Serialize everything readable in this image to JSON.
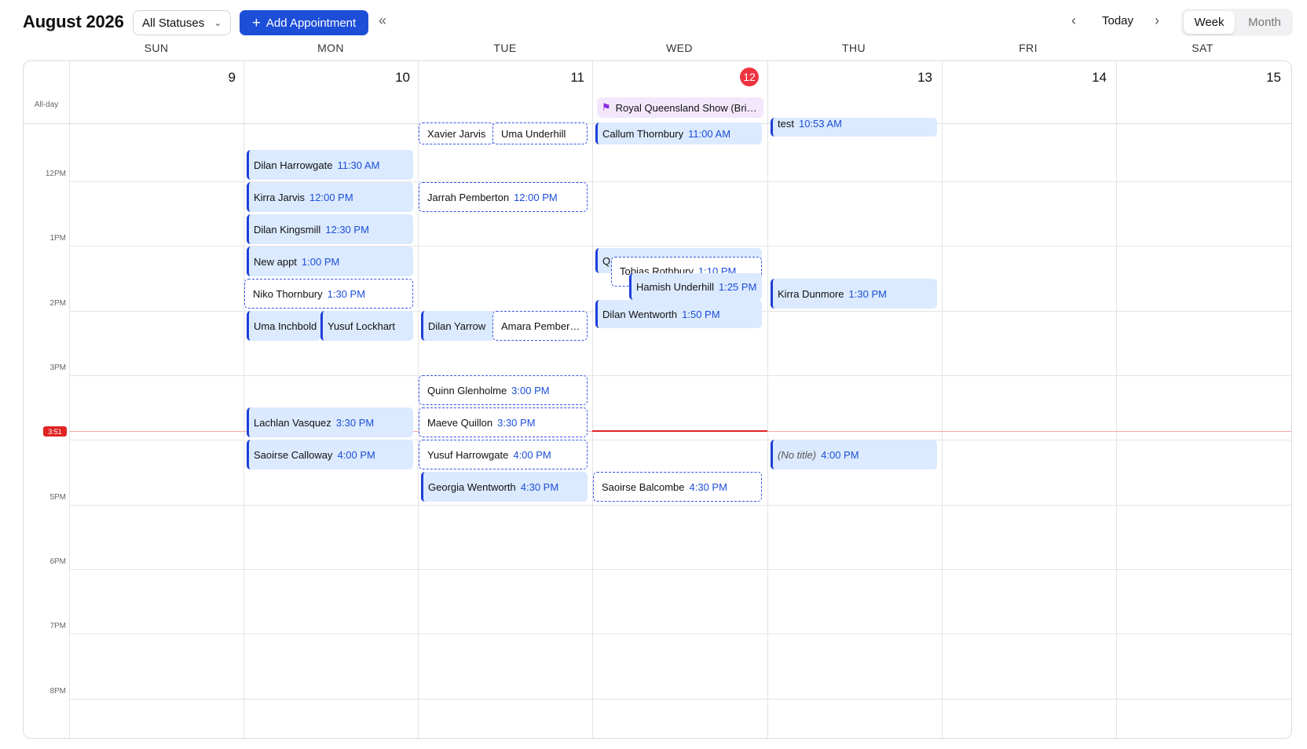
{
  "header": {
    "title": "August 2026",
    "status_filter": "All Statuses",
    "add_label": "Add Appointment",
    "today_label": "Today",
    "view_week": "Week",
    "view_month": "Month"
  },
  "days": [
    {
      "name": "SUN",
      "date": "9"
    },
    {
      "name": "MON",
      "date": "10"
    },
    {
      "name": "TUE",
      "date": "11"
    },
    {
      "name": "WED",
      "date": "12"
    },
    {
      "name": "THU",
      "date": "13"
    },
    {
      "name": "FRI",
      "date": "14"
    },
    {
      "name": "SAT",
      "date": "15"
    }
  ],
  "allday": {
    "label": "All-day",
    "event": "Royal Queensland Show (Bri…"
  },
  "times": [
    "12PM",
    "1PM",
    "2PM",
    "3PM",
    "5PM",
    "6PM",
    "7PM",
    "8PM"
  ],
  "now_label": "3:51",
  "events": {
    "mon": [
      {
        "name": "Dilan Harrowgate",
        "time": "11:30 AM"
      },
      {
        "name": "Kirra Jarvis",
        "time": "12:00 PM"
      },
      {
        "name": "Dilan Kingsmill",
        "time": "12:30 PM"
      },
      {
        "name": "New appt",
        "time": "1:00 PM"
      },
      {
        "name": "Niko Thornbury",
        "time": "1:30 PM"
      },
      {
        "name": "Uma Inchbold",
        "time": ""
      },
      {
        "name": "Yusuf Lockhart",
        "time": ""
      },
      {
        "name": "Lachlan Vasquez",
        "time": "3:30 PM"
      },
      {
        "name": "Saoirse Calloway",
        "time": "4:00 PM"
      }
    ],
    "tue": [
      {
        "name": "Xavier Jarvis",
        "time": ""
      },
      {
        "name": "Uma Underhill",
        "time": ""
      },
      {
        "name": "Jarrah Pemberton",
        "time": "12:00 PM"
      },
      {
        "name": "Dilan Yarrow",
        "time": ""
      },
      {
        "name": "Amara Pember…",
        "time": ""
      },
      {
        "name": "Quinn Glenholme",
        "time": "3:00 PM"
      },
      {
        "name": "Maeve Quillon",
        "time": "3:30 PM"
      },
      {
        "name": "Yusuf Harrowgate",
        "time": "4:00 PM"
      },
      {
        "name": "Georgia Wentworth",
        "time": "4:30 PM"
      }
    ],
    "wed": [
      {
        "name": "Callum Thornbury",
        "time": "11:00 AM"
      },
      {
        "name": "Q",
        "time": ""
      },
      {
        "name": "Tobias Rothbury",
        "time": "1:10 PM"
      },
      {
        "name": "Hamish Underhill",
        "time": "1:25 PM"
      },
      {
        "name": "Dilan Wentworth",
        "time": "1:50 PM"
      },
      {
        "name": "Saoirse Balcombe",
        "time": "4:30 PM"
      }
    ],
    "thu": [
      {
        "name": "test",
        "time": "10:53 AM"
      },
      {
        "name": "Kirra Dunmore",
        "time": "1:30 PM"
      },
      {
        "name": "(No title)",
        "time": "4:00 PM"
      }
    ]
  }
}
